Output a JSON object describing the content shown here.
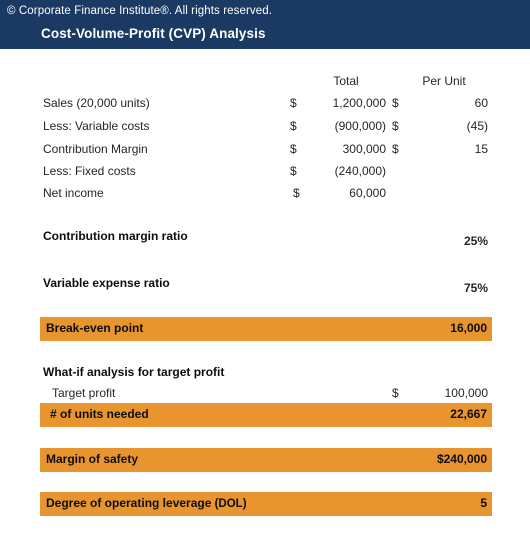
{
  "header": {
    "copyright": "© Corporate Finance Institute®. All rights reserved.",
    "title": "Cost-Volume-Profit (CVP) Analysis",
    "band_color": "#1b3a63",
    "text_color": "#ffffff"
  },
  "accent": {
    "highlight_color": "#e8942f",
    "highlight_text_color": "#0d0d0d"
  },
  "income_table": {
    "columns": {
      "total": "Total",
      "per_unit": "Per Unit"
    },
    "rows": [
      {
        "label": "Sales (20,000 units)",
        "total_symbol": "$",
        "total": "1,200,000",
        "unit_symbol": "$",
        "unit": "60"
      },
      {
        "label": "Less: Variable costs",
        "total_symbol": "$",
        "total": "(900,000)",
        "unit_symbol": "$",
        "unit": "(45)"
      },
      {
        "label": "Contribution Margin",
        "total_symbol": "$",
        "total": "300,000",
        "unit_symbol": "$",
        "unit": "15"
      },
      {
        "label": "Less: Fixed costs",
        "total_symbol": "$",
        "total": "(240,000)",
        "unit_symbol": "",
        "unit": ""
      },
      {
        "label": "Net income",
        "total_symbol": "$",
        "total": "60,000",
        "unit_symbol": "",
        "unit": ""
      }
    ]
  },
  "ratios": [
    {
      "label": "Contribution margin ratio",
      "value": "25%"
    },
    {
      "label": "Variable expense ratio",
      "value": "75%"
    }
  ],
  "break_even": {
    "label": "Break-even point",
    "value": "16,000"
  },
  "what_if": {
    "heading": "What-if analysis for target profit",
    "target_profit_label": "Target profit",
    "target_profit_symbol": "$",
    "target_profit_value": "100,000",
    "units_needed_label": "# of units needed",
    "units_needed_value": "22,667"
  },
  "margin_of_safety": {
    "label": "Margin of safety",
    "value": "$240,000"
  },
  "dol": {
    "label_main": "Degree of operating leverage",
    "label_sub": " (DOL)",
    "value": "5"
  }
}
